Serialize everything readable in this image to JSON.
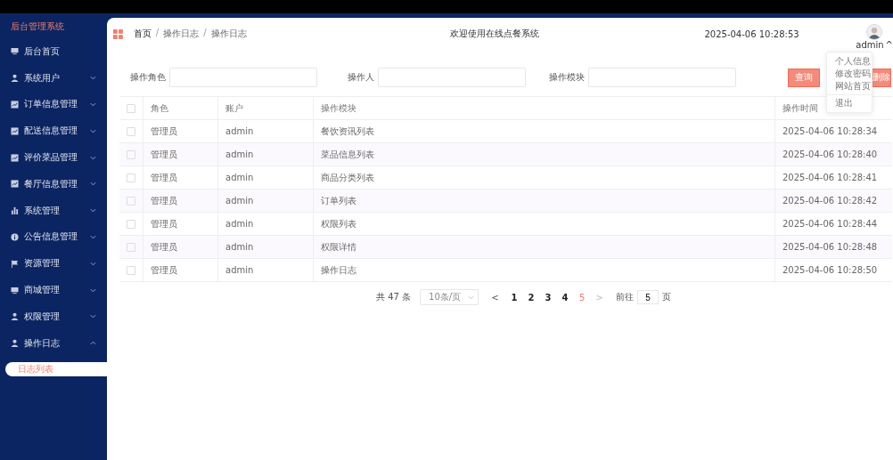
{
  "sidebar": {
    "title": "后台管理系统",
    "items": [
      {
        "label": "后台首页",
        "expandable": false
      },
      {
        "label": "系统用户",
        "expandable": true,
        "expanded": false
      },
      {
        "label": "订单信息管理",
        "expandable": true,
        "expanded": false
      },
      {
        "label": "配送信息管理",
        "expandable": true,
        "expanded": false
      },
      {
        "label": "评价菜品管理",
        "expandable": true,
        "expanded": false
      },
      {
        "label": "餐厅信息管理",
        "expandable": true,
        "expanded": false
      },
      {
        "label": "系统管理",
        "expandable": true,
        "expanded": false
      },
      {
        "label": "公告信息管理",
        "expandable": true,
        "expanded": false
      },
      {
        "label": "资源管理",
        "expandable": true,
        "expanded": false
      },
      {
        "label": "商城管理",
        "expandable": true,
        "expanded": false
      },
      {
        "label": "权限管理",
        "expandable": true,
        "expanded": false
      },
      {
        "label": "操作日志",
        "expandable": true,
        "expanded": true,
        "children": [
          {
            "label": "日志列表",
            "selected": true
          }
        ]
      }
    ]
  },
  "breadcrumb": [
    "首页",
    "操作日志",
    "操作日志"
  ],
  "breadcrumb_separator": "/",
  "welcome": "欢迎使用在线点餐系统",
  "clock": "2025-04-06 10:28:53",
  "user": {
    "name": "admin",
    "caret": "^"
  },
  "user_menu": [
    "个人信息",
    "修改密码",
    "网站首页",
    "退出"
  ],
  "filters": [
    {
      "label": "操作角色"
    },
    {
      "label": "操作人"
    },
    {
      "label": "操作模块"
    }
  ],
  "buttons": [
    {
      "label": "查询"
    },
    {
      "label": "删除"
    }
  ],
  "table": {
    "all_checked": false,
    "columns": [
      "角色",
      "账户",
      "操作模块",
      "操作时间"
    ],
    "rows": [
      {
        "checked": false,
        "cells": [
          "管理员",
          "admin",
          "餐饮资讯列表",
          "2025-04-06 10:28:34"
        ]
      },
      {
        "checked": false,
        "cells": [
          "管理员",
          "admin",
          "菜品信息列表",
          "2025-04-06 10:28:40"
        ]
      },
      {
        "checked": false,
        "cells": [
          "管理员",
          "admin",
          "商品分类列表",
          "2025-04-06 10:28:41"
        ]
      },
      {
        "checked": false,
        "cells": [
          "管理员",
          "admin",
          "订单列表",
          "2025-04-06 10:28:42"
        ]
      },
      {
        "checked": false,
        "cells": [
          "管理员",
          "admin",
          "权限列表",
          "2025-04-06 10:28:44"
        ]
      },
      {
        "checked": false,
        "cells": [
          "管理员",
          "admin",
          "权限详情",
          "2025-04-06 10:28:48"
        ]
      },
      {
        "checked": false,
        "cells": [
          "管理员",
          "admin",
          "操作日志",
          "2025-04-06 10:28:50"
        ]
      }
    ]
  },
  "pagination": {
    "total": "共 47 条",
    "page_size": "10条/页",
    "prev": "<",
    "pages": [
      {
        "label": "1",
        "selected": false
      },
      {
        "label": "2",
        "selected": false
      },
      {
        "label": "3",
        "selected": false
      },
      {
        "label": "4",
        "selected": false
      },
      {
        "label": "5",
        "selected": true
      }
    ],
    "next": ">",
    "goto_label": "前往",
    "goto_value": "5",
    "goto_suffix": "页"
  }
}
